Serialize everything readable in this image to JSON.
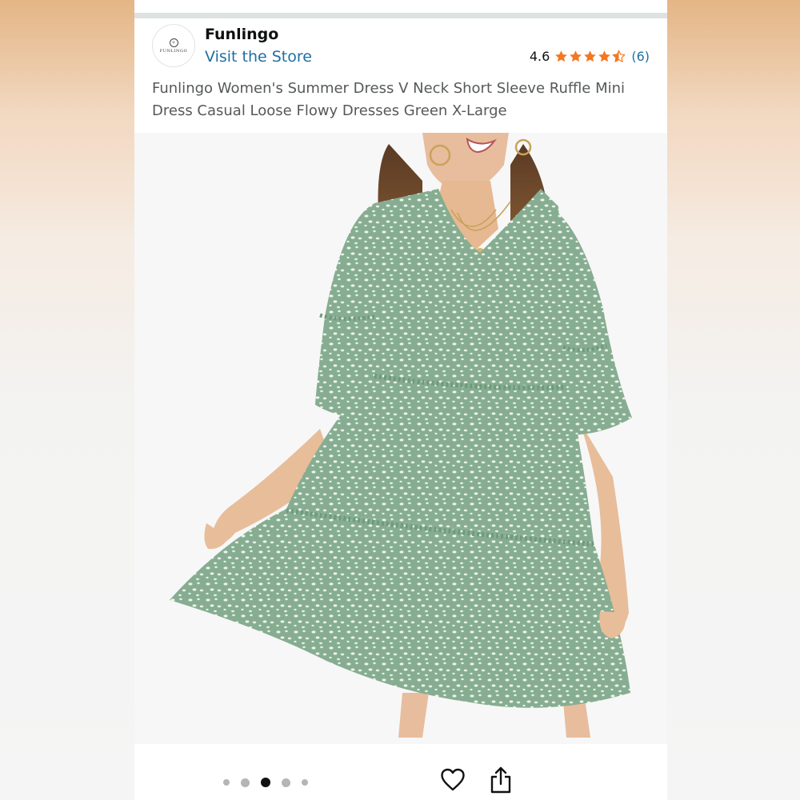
{
  "store": {
    "logo_text": "FUNLINGO",
    "name": "Funlingo",
    "visit_label": "Visit the Store"
  },
  "rating": {
    "value": "4.6",
    "stars": 4.5,
    "count_label": "(6)"
  },
  "product": {
    "title": "Funlingo Women's Summer Dress V Neck Short Sleeve Ruffle Mini Dress Casual Loose Flowy Dresses Green X-Large",
    "image_icon": "product-photo-green-leopard-print-ruffle-dress"
  },
  "carousel": {
    "total": 5,
    "active_index": 2
  },
  "actions": {
    "favorite_icon": "heart-icon",
    "share_icon": "share-icon"
  },
  "colors": {
    "link": "#1f6fa3",
    "star": "#f47721",
    "title_text": "#565959",
    "dress": "#86ad91"
  }
}
